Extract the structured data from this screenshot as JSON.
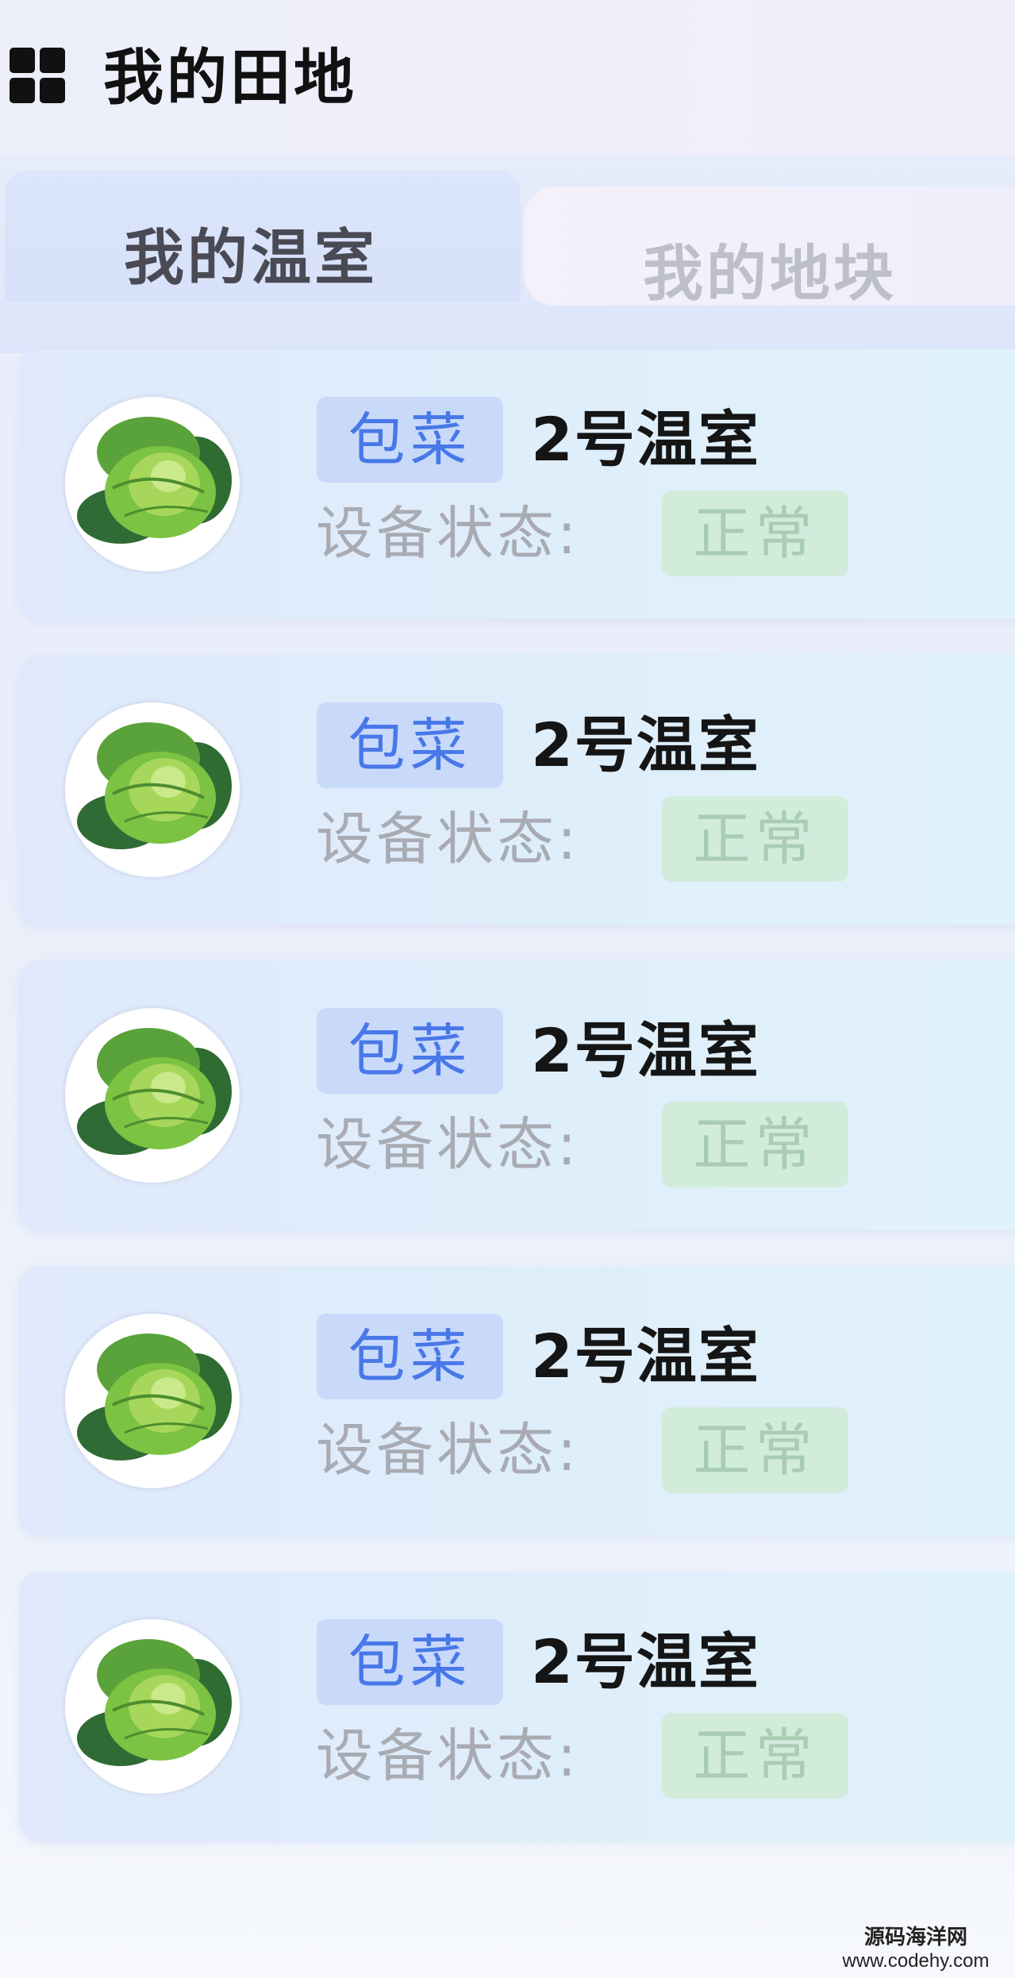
{
  "header": {
    "title": "我的田地",
    "icon": "grid-icon"
  },
  "tabs": [
    {
      "label": "我的温室",
      "active": true
    },
    {
      "label": "我的地块",
      "active": false
    }
  ],
  "greenhouses": [
    {
      "crop": "包菜",
      "name": "2号温室",
      "status_label": "设备状态:",
      "status": "正常",
      "image": "cabbage-image"
    },
    {
      "crop": "包菜",
      "name": "2号温室",
      "status_label": "设备状态:",
      "status": "正常",
      "image": "cabbage-image"
    },
    {
      "crop": "包菜",
      "name": "2号温室",
      "status_label": "设备状态:",
      "status": "正常",
      "image": "cabbage-image"
    },
    {
      "crop": "包菜",
      "name": "2号温室",
      "status_label": "设备状态:",
      "status": "正常",
      "image": "cabbage-image"
    },
    {
      "crop": "包菜",
      "name": "2号温室",
      "status_label": "设备状态:",
      "status": "正常",
      "image": "cabbage-image"
    }
  ],
  "colors": {
    "accent_blue": "#4878e8",
    "status_green_bg": "#d2ecdc",
    "status_green_text": "#a9cdb3"
  },
  "watermark": {
    "line1": "源码海洋网",
    "line2": "www.codehy.com"
  }
}
